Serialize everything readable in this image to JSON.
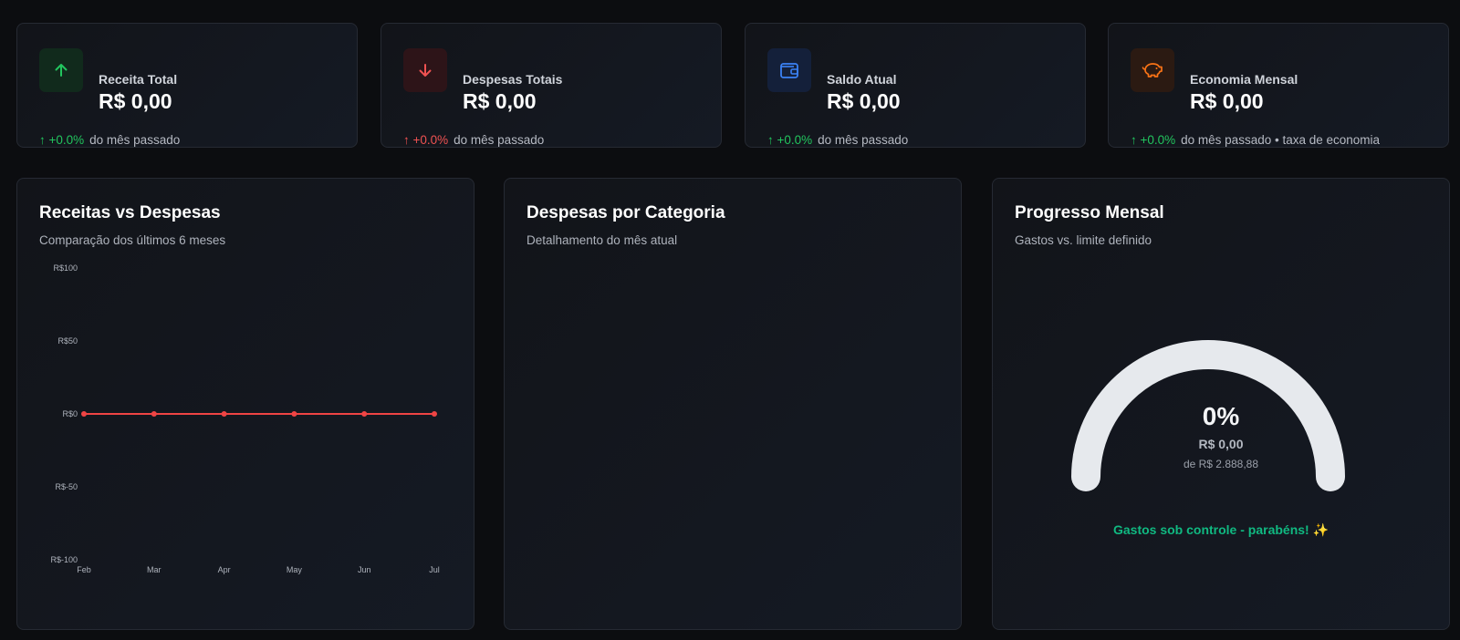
{
  "stats": [
    {
      "label": "Receita Total",
      "value": "R$ 0,00",
      "change": "↑ +0.0%",
      "note": "do mês passado",
      "icon": "arrow-up-icon",
      "accent": "#22c55e",
      "icon_bg": "#112a1c"
    },
    {
      "label": "Despesas Totais",
      "value": "R$ 0,00",
      "change": "↑ +0.0%",
      "note": "do mês passado",
      "icon": "arrow-down-icon",
      "accent": "#f05252",
      "icon_bg": "#2d1418"
    },
    {
      "label": "Saldo Atual",
      "value": "R$ 0,00",
      "change": "↑ +0.0%",
      "note": "do mês passado",
      "icon": "wallet-icon",
      "accent": "#3b82f6",
      "icon_bg": "#14203a"
    },
    {
      "label": "Economia Mensal",
      "value": "R$ 0,00",
      "change": "↑ +0.0%",
      "note": "do mês passado • taxa de economia",
      "icon": "piggy-bank-icon",
      "accent": "#f97316",
      "icon_bg": "#2b1a12"
    }
  ],
  "panels": {
    "income_vs_expense": {
      "title": "Receitas vs Despesas",
      "subtitle": "Comparação dos últimos 6 meses"
    },
    "by_category": {
      "title": "Despesas por Categoria",
      "subtitle": "Detalhamento do mês atual"
    },
    "monthly_progress": {
      "title": "Progresso Mensal",
      "subtitle": "Gastos vs. limite definido",
      "percent": "0%",
      "spent": "R$ 0,00",
      "limit": "de R$ 2.888,88",
      "progress_fraction": 0,
      "message": "Gastos sob controle - parabéns! ✨"
    }
  },
  "chart_data": {
    "type": "line",
    "x": [
      "Feb",
      "Mar",
      "Apr",
      "May",
      "Jun",
      "Jul"
    ],
    "series": [
      {
        "values": [
          0,
          0,
          0,
          0,
          0,
          0
        ],
        "color": "#ef4444"
      }
    ],
    "y_ticks": [
      "R$100",
      "R$50",
      "R$0",
      "R$-50",
      "R$-100"
    ],
    "ylim": [
      -100,
      100
    ],
    "grid": false
  }
}
